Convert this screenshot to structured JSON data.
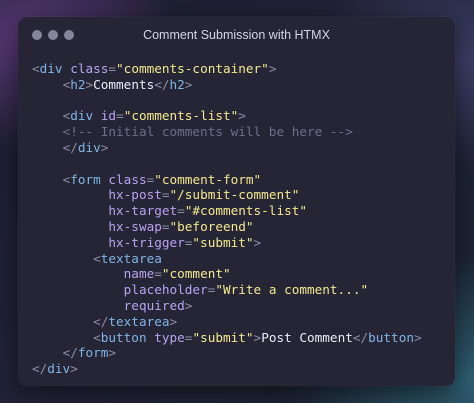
{
  "window": {
    "title": "Comment Submission with HTMX"
  },
  "code": {
    "lines": [
      [
        [
          "p",
          "<"
        ],
        [
          "t",
          "div"
        ],
        [
          "x",
          " "
        ],
        [
          "a",
          "class"
        ],
        [
          "p",
          "="
        ],
        [
          "s",
          "\"comments-container\""
        ],
        [
          "p",
          ">"
        ]
      ],
      [
        [
          "x",
          "    "
        ],
        [
          "p",
          "<"
        ],
        [
          "t",
          "h2"
        ],
        [
          "p",
          ">"
        ],
        [
          "x",
          "Comments"
        ],
        [
          "p",
          "</"
        ],
        [
          "t",
          "h2"
        ],
        [
          "p",
          ">"
        ]
      ],
      [],
      [
        [
          "x",
          "    "
        ],
        [
          "p",
          "<"
        ],
        [
          "t",
          "div"
        ],
        [
          "x",
          " "
        ],
        [
          "a",
          "id"
        ],
        [
          "p",
          "="
        ],
        [
          "s",
          "\"comments-list\""
        ],
        [
          "p",
          ">"
        ]
      ],
      [
        [
          "x",
          "    "
        ],
        [
          "c",
          "<!-- Initial comments will be here -->"
        ]
      ],
      [
        [
          "x",
          "    "
        ],
        [
          "p",
          "</"
        ],
        [
          "t",
          "div"
        ],
        [
          "p",
          ">"
        ]
      ],
      [],
      [
        [
          "x",
          "    "
        ],
        [
          "p",
          "<"
        ],
        [
          "t",
          "form"
        ],
        [
          "x",
          " "
        ],
        [
          "a",
          "class"
        ],
        [
          "p",
          "="
        ],
        [
          "s",
          "\"comment-form\""
        ]
      ],
      [
        [
          "x",
          "          "
        ],
        [
          "a",
          "hx-post"
        ],
        [
          "p",
          "="
        ],
        [
          "s",
          "\"/submit-comment\""
        ]
      ],
      [
        [
          "x",
          "          "
        ],
        [
          "a",
          "hx-target"
        ],
        [
          "p",
          "="
        ],
        [
          "s",
          "\"#comments-list\""
        ]
      ],
      [
        [
          "x",
          "          "
        ],
        [
          "a",
          "hx-swap"
        ],
        [
          "p",
          "="
        ],
        [
          "s",
          "\"beforeend\""
        ]
      ],
      [
        [
          "x",
          "          "
        ],
        [
          "a",
          "hx-trigger"
        ],
        [
          "p",
          "="
        ],
        [
          "s",
          "\"submit\""
        ],
        [
          "p",
          ">"
        ]
      ],
      [
        [
          "x",
          "        "
        ],
        [
          "p",
          "<"
        ],
        [
          "t",
          "textarea"
        ]
      ],
      [
        [
          "x",
          "            "
        ],
        [
          "a",
          "name"
        ],
        [
          "p",
          "="
        ],
        [
          "s",
          "\"comment\""
        ]
      ],
      [
        [
          "x",
          "            "
        ],
        [
          "a",
          "placeholder"
        ],
        [
          "p",
          "="
        ],
        [
          "s",
          "\"Write a comment...\""
        ]
      ],
      [
        [
          "x",
          "            "
        ],
        [
          "a",
          "required"
        ],
        [
          "p",
          ">"
        ]
      ],
      [
        [
          "x",
          "        "
        ],
        [
          "p",
          "</"
        ],
        [
          "t",
          "textarea"
        ],
        [
          "p",
          ">"
        ]
      ],
      [
        [
          "x",
          "        "
        ],
        [
          "p",
          "<"
        ],
        [
          "t",
          "button"
        ],
        [
          "x",
          " "
        ],
        [
          "a",
          "type"
        ],
        [
          "p",
          "="
        ],
        [
          "s",
          "\"submit\""
        ],
        [
          "p",
          ">"
        ],
        [
          "x",
          "Post Comment"
        ],
        [
          "p",
          "</"
        ],
        [
          "t",
          "button"
        ],
        [
          "p",
          ">"
        ]
      ],
      [
        [
          "x",
          "    "
        ],
        [
          "p",
          "</"
        ],
        [
          "t",
          "form"
        ],
        [
          "p",
          ">"
        ]
      ],
      [
        [
          "p",
          "</"
        ],
        [
          "t",
          "div"
        ],
        [
          "p",
          ">"
        ]
      ]
    ]
  }
}
